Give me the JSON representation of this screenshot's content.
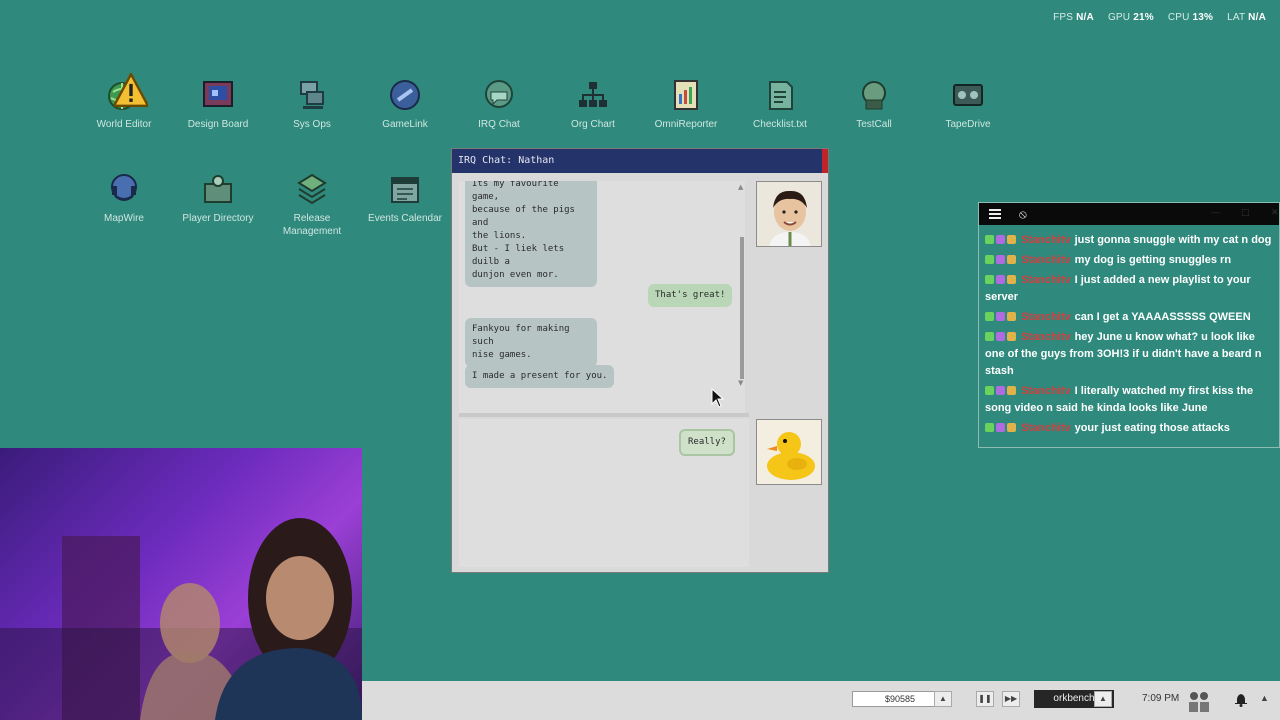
{
  "perf": {
    "fps_label": "FPS",
    "fps_value": "N/A",
    "gpu_label": "GPU",
    "gpu_value": "21%",
    "cpu_label": "CPU",
    "cpu_value": "13%",
    "lat_label": "LAT",
    "lat_value": "N/A"
  },
  "desktop_icons": [
    {
      "label": "World Editor",
      "icon": "globe-edit-icon"
    },
    {
      "label": "Design Board",
      "icon": "design-board-icon"
    },
    {
      "label": "Sys Ops",
      "icon": "sys-ops-icon"
    },
    {
      "label": "GameLink",
      "icon": "gamelink-icon"
    },
    {
      "label": "IRQ Chat",
      "icon": "irq-chat-icon"
    },
    {
      "label": "Org Chart",
      "icon": "org-chart-icon"
    },
    {
      "label": "OmniReporter",
      "icon": "omnireporter-icon"
    },
    {
      "label": "Checklist.txt",
      "icon": "checklist-icon"
    },
    {
      "label": "TestCall",
      "icon": "testcall-icon"
    },
    {
      "label": "TapeDrive",
      "icon": "tapedrive-icon"
    },
    {
      "label": "MapWire",
      "icon": "mapwire-icon"
    },
    {
      "label": "Player Directory",
      "icon": "player-directory-icon"
    },
    {
      "label": "Release Management",
      "icon": "release-management-icon"
    },
    {
      "label": "Events Calendar",
      "icon": "events-calendar-icon"
    }
  ],
  "chat_window": {
    "title": "IRQ Chat: Nathan",
    "messages": [
      {
        "from": "them",
        "text": "Its my favourite game,\nbecause of the pigs and\nthe lions."
      },
      {
        "from": "them",
        "text": "But - I liek lets duilb a\ndunjon even mor."
      },
      {
        "from": "me",
        "text": "That's great!"
      },
      {
        "from": "them",
        "text": "Fankyou for making such\nnise games."
      },
      {
        "from": "them",
        "text": "I made a present for you."
      }
    ],
    "reply_option": "Really?"
  },
  "stream_chat": {
    "messages": [
      {
        "user": "Stanchitv",
        "text": "just gonna snuggle with my cat n dog"
      },
      {
        "user": "Stanchitv",
        "text": "my dog is getting snuggles rn"
      },
      {
        "user": "Stanchitv",
        "text": "I just added a new playlist to your server"
      },
      {
        "user": "Stanchitv",
        "text": "can I get a YAAAASSSSS QWEEN"
      },
      {
        "user": "Stanchitv",
        "text": "hey June u know what? u look like one of the guys from 3OH!3 if u didn't have a beard n stash"
      },
      {
        "user": "Stanchitv",
        "text": "I literally watched my first kiss the song video n said he kinda looks like June"
      },
      {
        "user": "Stanchitv",
        "text": "your just eating those attacks"
      }
    ]
  },
  "taskbar": {
    "money": "$90585",
    "project": "orkbench",
    "time": "7:09 PM"
  }
}
